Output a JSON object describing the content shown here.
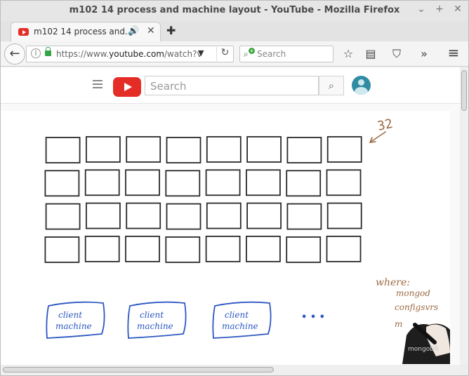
{
  "window": {
    "title": "m102 14 process and machine layout - YouTube - Mozilla Firefox",
    "controls": {
      "minimize": "⌄",
      "maximize": "+",
      "close": "✕"
    }
  },
  "tab": {
    "title": "m102 14 process and...",
    "icon": "youtube-icon",
    "sound_icon": "🔊",
    "close": "✕",
    "new_tab": "✚"
  },
  "navbar": {
    "url_prefix": "https://www.",
    "url_host": "youtube.com",
    "url_rest": "/watch?v",
    "search_placeholder": "Search",
    "dropdown": "▼",
    "reload": "↻",
    "back": "←",
    "toolbar_icons": [
      "star-icon",
      "reading-list-icon",
      "pocket-icon",
      "overflow-icon",
      "menu-icon"
    ],
    "toolbar_glyphs": [
      "☆",
      "▤",
      "⛉",
      "»",
      "≡"
    ]
  },
  "youtube": {
    "search_placeholder": "Search",
    "search_button": "⌕"
  },
  "video": {
    "annotation_count": "32",
    "grid": {
      "rows": 4,
      "cols": 8
    },
    "clients": [
      "client\nmachine",
      "client\nmachine",
      "client\nmachine"
    ],
    "ellipsis": "• • •",
    "where_title": "where:",
    "where_items": [
      "mongod",
      "configsvrs",
      "m"
    ],
    "watermark": "mongoDB"
  },
  "colors": {
    "ink_black": "#2a2a2a",
    "ink_blue": "#2c57c2",
    "ink_brown": "#9b6a43",
    "youtube_red": "#e52d27"
  }
}
